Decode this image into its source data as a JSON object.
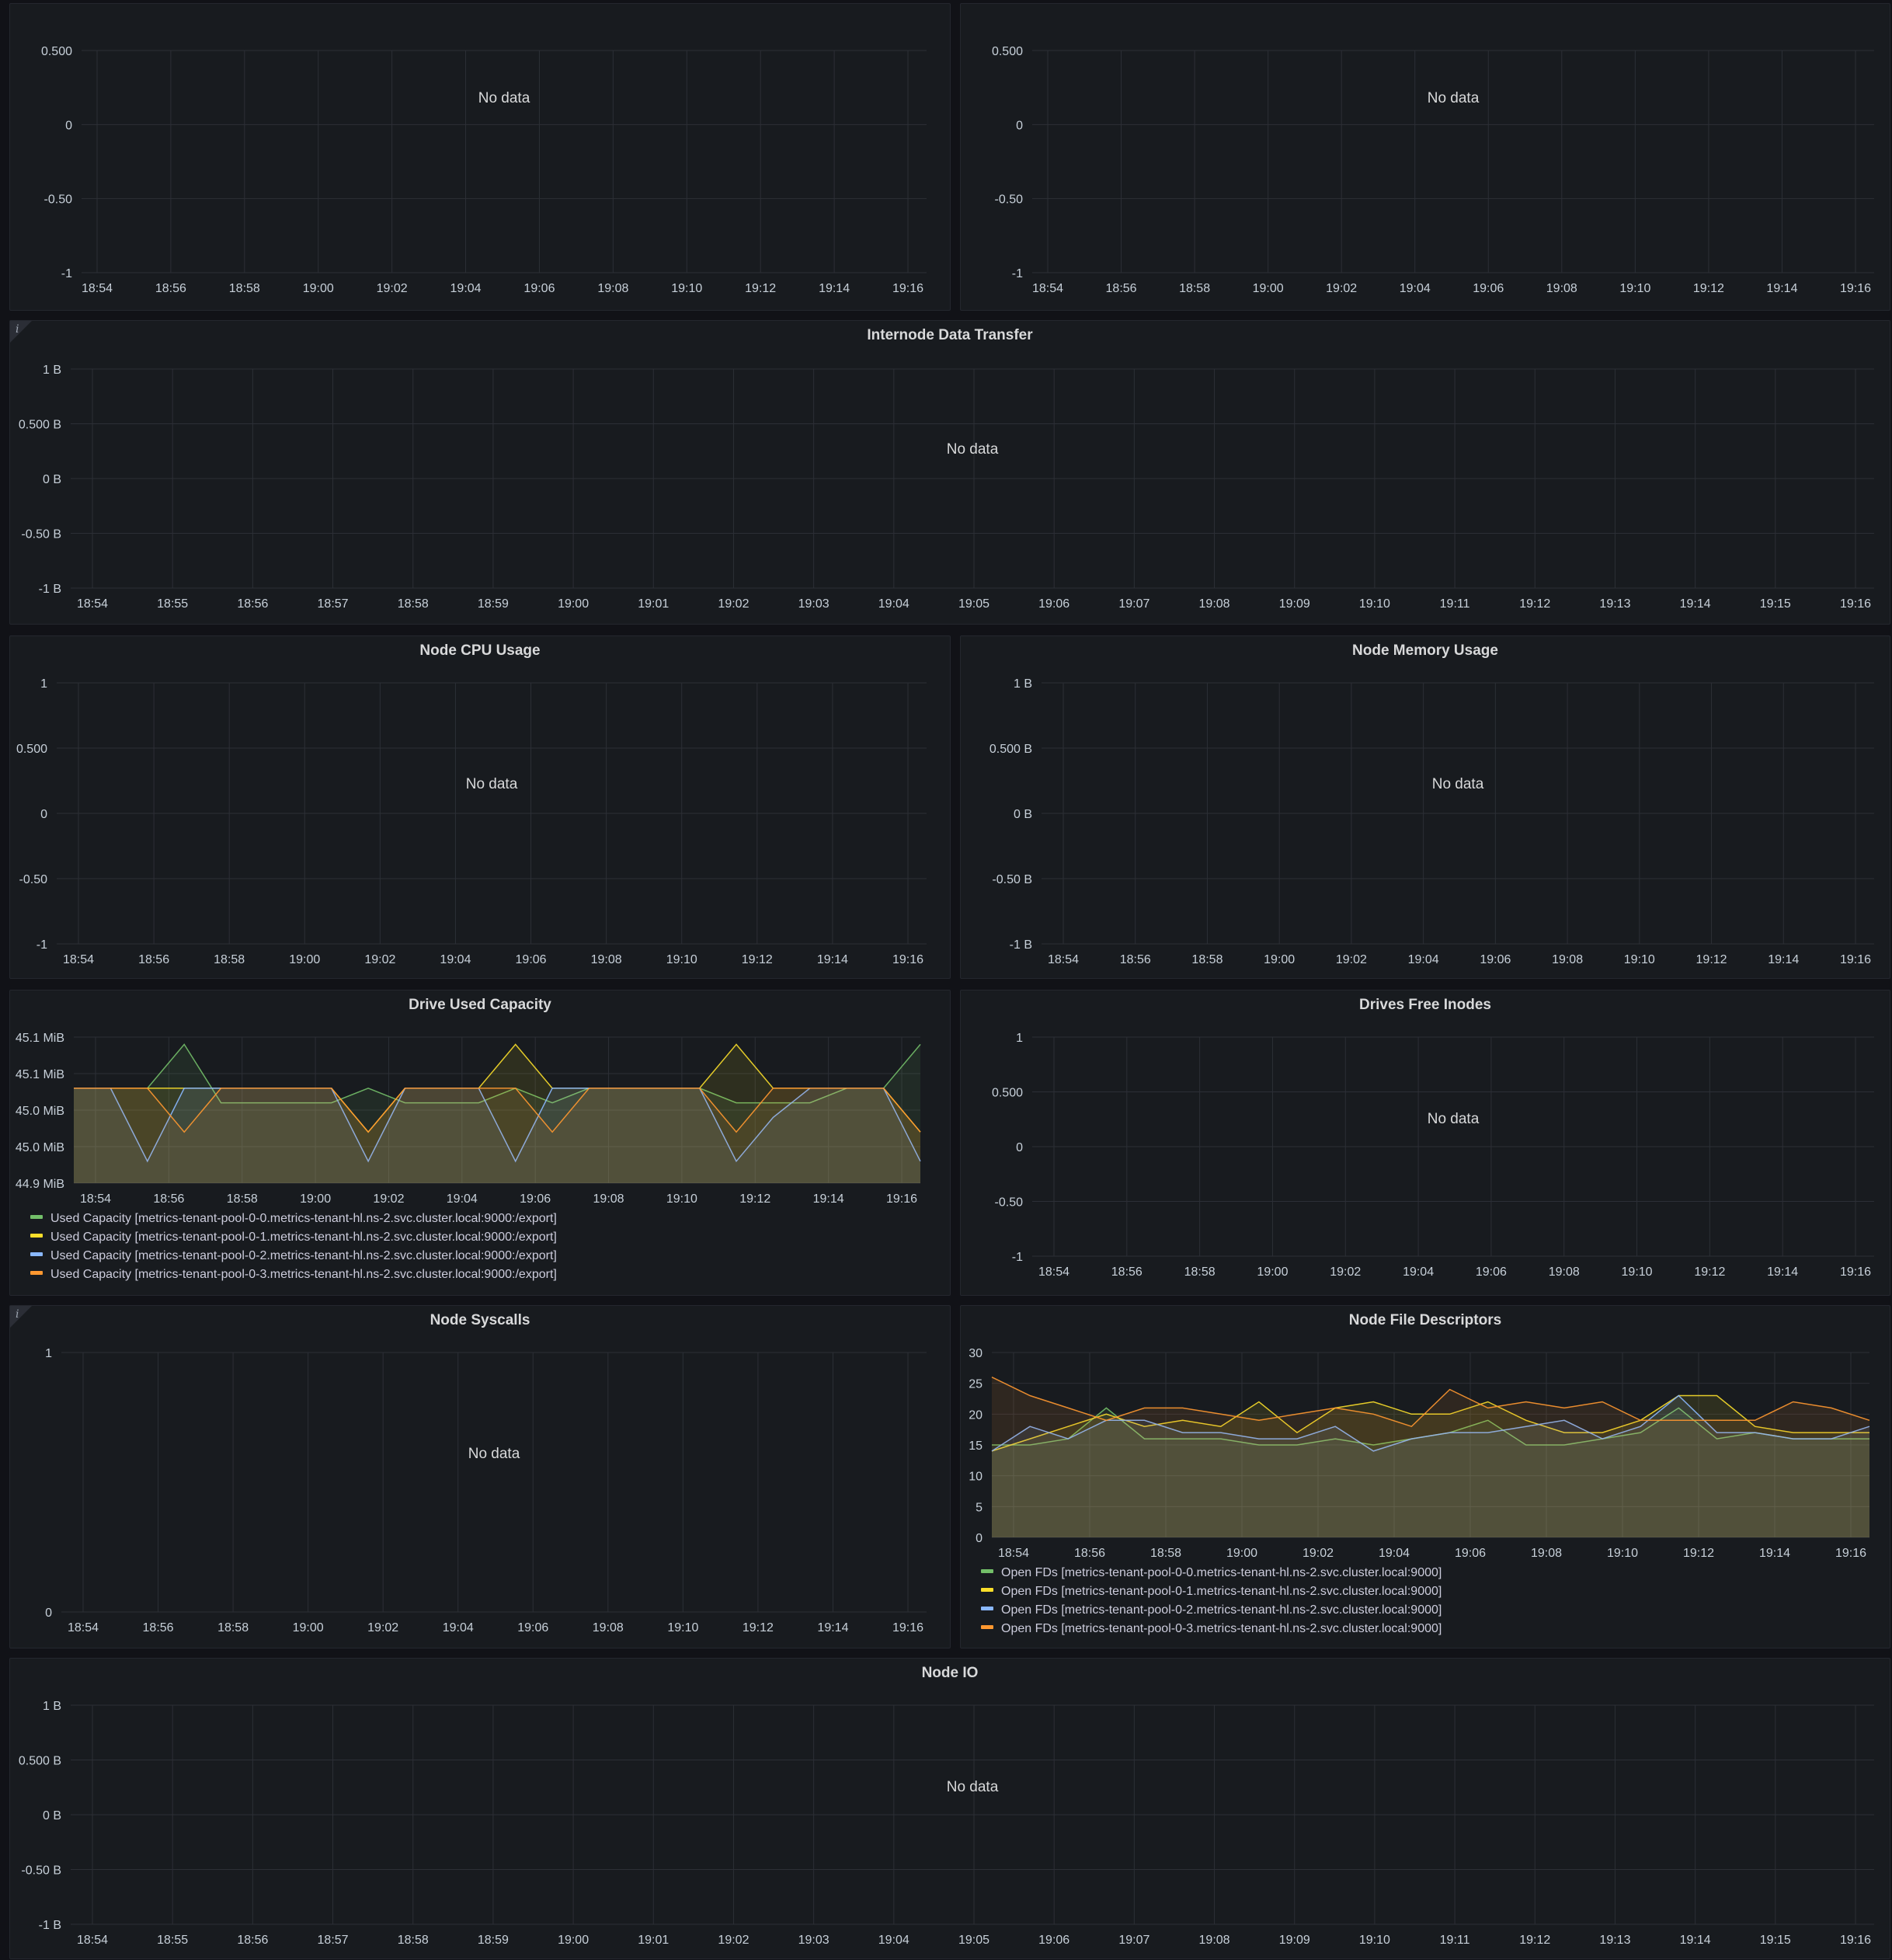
{
  "no_data_label": "No data",
  "colors": {
    "series_green": "#73bf69",
    "series_yellow": "#fade2a",
    "series_blue": "#8ab8ff",
    "series_orange": "#ff9830",
    "grid": "#2c2f36",
    "axis_text": "#c7d0d9"
  },
  "panels": {
    "top_left": {
      "title": "",
      "y_ticks": [
        "0.500",
        "0",
        "-0.50",
        "-1"
      ]
    },
    "top_right": {
      "title": "",
      "y_ticks": [
        "0.500",
        "0",
        "-0.50",
        "-1"
      ]
    },
    "internode": {
      "title": "Internode Data Transfer",
      "info_icon": "info-icon",
      "y_ticks": [
        "1 B",
        "0.500 B",
        "0 B",
        "-0.50 B",
        "-1 B"
      ]
    },
    "cpu": {
      "title": "Node CPU Usage",
      "y_ticks": [
        "1",
        "0.500",
        "0",
        "-0.50",
        "-1"
      ]
    },
    "memory": {
      "title": "Node Memory Usage",
      "y_ticks": [
        "1 B",
        "0.500 B",
        "0 B",
        "-0.50 B",
        "-1 B"
      ]
    },
    "drive_used": {
      "title": "Drive Used Capacity",
      "y_ticks": [
        "45.1 MiB",
        "45.1 MiB",
        "45.0 MiB",
        "45.0 MiB",
        "44.9 MiB"
      ],
      "legend": [
        "Used Capacity [metrics-tenant-pool-0-0.metrics-tenant-hl.ns-2.svc.cluster.local:9000:/export]",
        "Used Capacity [metrics-tenant-pool-0-1.metrics-tenant-hl.ns-2.svc.cluster.local:9000:/export]",
        "Used Capacity [metrics-tenant-pool-0-2.metrics-tenant-hl.ns-2.svc.cluster.local:9000:/export]",
        "Used Capacity [metrics-tenant-pool-0-3.metrics-tenant-hl.ns-2.svc.cluster.local:9000:/export]"
      ]
    },
    "inodes": {
      "title": "Drives Free Inodes",
      "y_ticks": [
        "1",
        "0.500",
        "0",
        "-0.50",
        "-1"
      ]
    },
    "syscalls": {
      "title": "Node Syscalls",
      "info_icon": "info-icon",
      "y_ticks": [
        "1",
        "0"
      ]
    },
    "fds": {
      "title": "Node File Descriptors",
      "y_ticks": [
        "30",
        "25",
        "20",
        "15",
        "10",
        "5",
        "0"
      ],
      "legend": [
        "Open FDs [metrics-tenant-pool-0-0.metrics-tenant-hl.ns-2.svc.cluster.local:9000]",
        "Open FDs [metrics-tenant-pool-0-1.metrics-tenant-hl.ns-2.svc.cluster.local:9000]",
        "Open FDs [metrics-tenant-pool-0-2.metrics-tenant-hl.ns-2.svc.cluster.local:9000]",
        "Open FDs [metrics-tenant-pool-0-3.metrics-tenant-hl.ns-2.svc.cluster.local:9000]"
      ]
    },
    "io": {
      "title": "Node IO",
      "y_ticks": [
        "1 B",
        "0.500 B",
        "0 B",
        "-0.50 B",
        "-1 B"
      ]
    }
  },
  "x_ticks_2min": [
    "18:54",
    "18:56",
    "18:58",
    "19:00",
    "19:02",
    "19:04",
    "19:06",
    "19:08",
    "19:10",
    "19:12",
    "19:14",
    "19:16"
  ],
  "x_ticks_1min": [
    "18:54",
    "18:55",
    "18:56",
    "18:57",
    "18:58",
    "18:59",
    "19:00",
    "19:01",
    "19:02",
    "19:03",
    "19:04",
    "19:05",
    "19:06",
    "19:07",
    "19:08",
    "19:09",
    "19:10",
    "19:11",
    "19:12",
    "19:13",
    "19:14",
    "19:15",
    "19:16"
  ],
  "chart_data": [
    {
      "type": "area",
      "title": "Drive Used Capacity",
      "ylabel": "",
      "ylim": [
        44.9,
        45.1
      ],
      "x": [
        "18:53",
        "18:54",
        "18:55",
        "18:56",
        "18:57",
        "18:58",
        "18:59",
        "19:00",
        "19:01",
        "19:02",
        "19:03",
        "19:04",
        "19:05",
        "19:06",
        "19:07",
        "19:08",
        "19:09",
        "19:10",
        "19:11",
        "19:12",
        "19:13",
        "19:14",
        "19:15",
        "19:16"
      ],
      "series": [
        {
          "name": "Used Capacity [metrics-tenant-pool-0-0.metrics-tenant-hl.ns-2.svc.cluster.local:9000:/export]",
          "values": [
            45.03,
            45.03,
            45.03,
            45.09,
            45.01,
            45.01,
            45.01,
            45.01,
            45.03,
            45.01,
            45.01,
            45.01,
            45.03,
            45.01,
            45.03,
            45.03,
            45.03,
            45.03,
            45.01,
            45.01,
            45.01,
            45.03,
            45.03,
            45.09
          ]
        },
        {
          "name": "Used Capacity [metrics-tenant-pool-0-1.metrics-tenant-hl.ns-2.svc.cluster.local:9000:/export]",
          "values": [
            45.03,
            45.03,
            45.03,
            45.03,
            45.03,
            45.03,
            45.03,
            45.03,
            44.97,
            45.03,
            45.03,
            45.03,
            45.09,
            45.03,
            45.03,
            45.03,
            45.03,
            45.03,
            45.09,
            45.03,
            45.03,
            45.03,
            45.03,
            44.97
          ]
        },
        {
          "name": "Used Capacity [metrics-tenant-pool-0-2.metrics-tenant-hl.ns-2.svc.cluster.local:9000:/export]",
          "values": [
            45.03,
            45.03,
            44.93,
            45.03,
            45.03,
            45.03,
            45.03,
            45.03,
            44.93,
            45.03,
            45.03,
            45.03,
            44.93,
            45.03,
            45.03,
            45.03,
            45.03,
            45.03,
            44.93,
            44.99,
            45.03,
            45.03,
            45.03,
            44.93
          ]
        },
        {
          "name": "Used Capacity [metrics-tenant-pool-0-3.metrics-tenant-hl.ns-2.svc.cluster.local:9000:/export]",
          "values": [
            45.03,
            45.03,
            45.03,
            44.97,
            45.03,
            45.03,
            45.03,
            45.03,
            44.97,
            45.03,
            45.03,
            45.03,
            45.03,
            44.97,
            45.03,
            45.03,
            45.03,
            45.03,
            44.97,
            45.03,
            45.03,
            45.03,
            45.03,
            44.97
          ]
        }
      ]
    },
    {
      "type": "area",
      "title": "Node File Descriptors",
      "ylabel": "",
      "ylim": [
        0,
        30
      ],
      "x": [
        "18:53",
        "18:54",
        "18:55",
        "18:56",
        "18:57",
        "18:58",
        "18:59",
        "19:00",
        "19:01",
        "19:02",
        "19:03",
        "19:04",
        "19:05",
        "19:06",
        "19:07",
        "19:08",
        "19:09",
        "19:10",
        "19:11",
        "19:12",
        "19:13",
        "19:14",
        "19:15",
        "19:16"
      ],
      "series": [
        {
          "name": "Open FDs [metrics-tenant-pool-0-0.metrics-tenant-hl.ns-2.svc.cluster.local:9000]",
          "values": [
            15,
            15,
            16,
            21,
            16,
            16,
            16,
            15,
            15,
            16,
            15,
            16,
            17,
            19,
            15,
            15,
            16,
            17,
            21,
            16,
            17,
            16,
            16,
            16
          ]
        },
        {
          "name": "Open FDs [metrics-tenant-pool-0-1.metrics-tenant-hl.ns-2.svc.cluster.local:9000]",
          "values": [
            14,
            16,
            18,
            20,
            18,
            19,
            18,
            22,
            17,
            21,
            22,
            20,
            20,
            22,
            19,
            17,
            17,
            19,
            23,
            23,
            18,
            17,
            17,
            17
          ]
        },
        {
          "name": "Open FDs [metrics-tenant-pool-0-2.metrics-tenant-hl.ns-2.svc.cluster.local:9000]",
          "values": [
            14,
            18,
            16,
            19,
            19,
            17,
            17,
            16,
            16,
            18,
            14,
            16,
            17,
            17,
            18,
            19,
            16,
            18,
            23,
            17,
            17,
            16,
            16,
            18
          ]
        },
        {
          "name": "Open FDs [metrics-tenant-pool-0-3.metrics-tenant-hl.ns-2.svc.cluster.local:9000]",
          "values": [
            26,
            23,
            21,
            19,
            21,
            21,
            20,
            19,
            20,
            21,
            20,
            18,
            24,
            21,
            22,
            21,
            22,
            19,
            19,
            19,
            19,
            22,
            21,
            19
          ]
        }
      ]
    }
  ]
}
